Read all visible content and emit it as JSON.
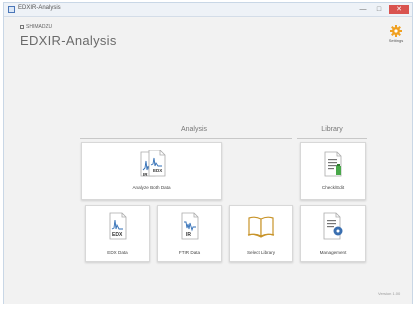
{
  "window": {
    "title": "EDXIR-Analysis",
    "minimize_glyph": "—",
    "maximize_glyph": "□",
    "close_glyph": "✕"
  },
  "header": {
    "brand": "SHIMADZU",
    "app_title": "EDXIR-Analysis",
    "settings_label": "Settings"
  },
  "sections": {
    "analysis_label": "Analysis",
    "library_label": "Library"
  },
  "tiles": {
    "analyze_both": {
      "label": "Analyze Both Data",
      "icon": "edx-ir-spectra-icon",
      "badge_top": "EDX",
      "badge_bottom": "IR"
    },
    "check_edit": {
      "label": "Check/Edit",
      "icon": "document-edit-icon"
    },
    "edx_data": {
      "label": "EDX Data",
      "icon": "edx-spectrum-icon",
      "badge": "EDX"
    },
    "ftir_data": {
      "label": "FTIR Data",
      "icon": "ir-spectrum-icon",
      "badge": "IR"
    },
    "select_library": {
      "label": "Select Library",
      "icon": "open-book-icon"
    },
    "management": {
      "label": "Management",
      "icon": "document-management-icon"
    }
  },
  "footer": {
    "version": "Version 1.00"
  },
  "colors": {
    "accent_blue": "#2f6db5",
    "settings_orange": "#f0a020",
    "book_gold": "#c8942a",
    "check_green": "#49a84a",
    "manage_blue": "#3a6fb0"
  }
}
